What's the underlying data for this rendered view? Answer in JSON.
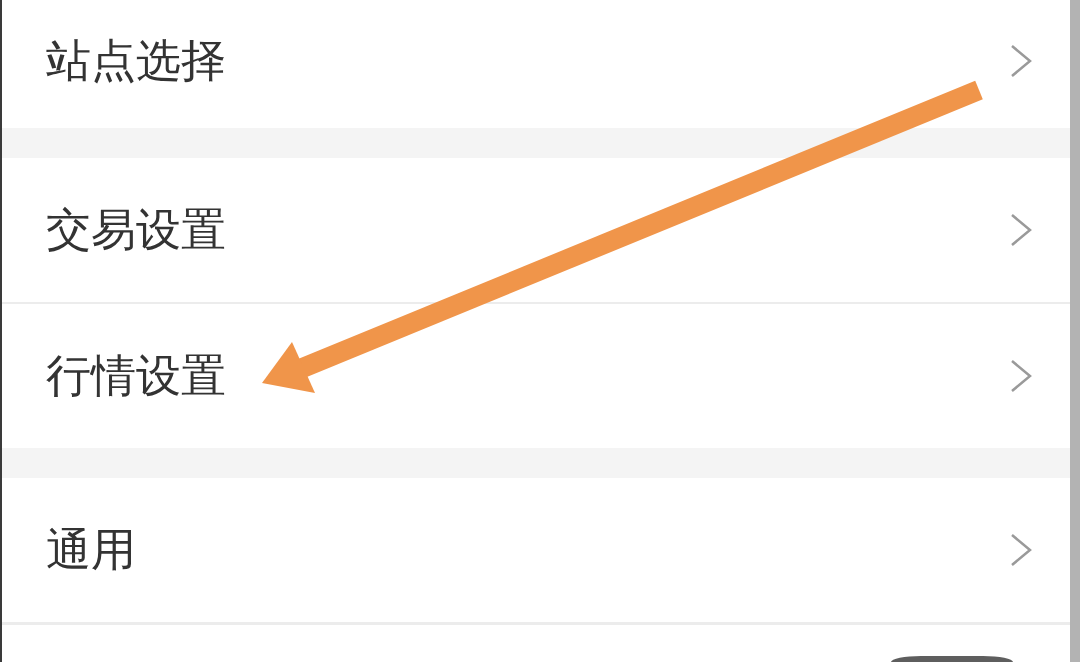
{
  "sections": [
    {
      "items": [
        {
          "label": "站点选择"
        }
      ]
    },
    {
      "items": [
        {
          "label": "交易设置"
        },
        {
          "label": "行情设置"
        }
      ]
    },
    {
      "items": [
        {
          "label": "通用"
        }
      ]
    }
  ]
}
